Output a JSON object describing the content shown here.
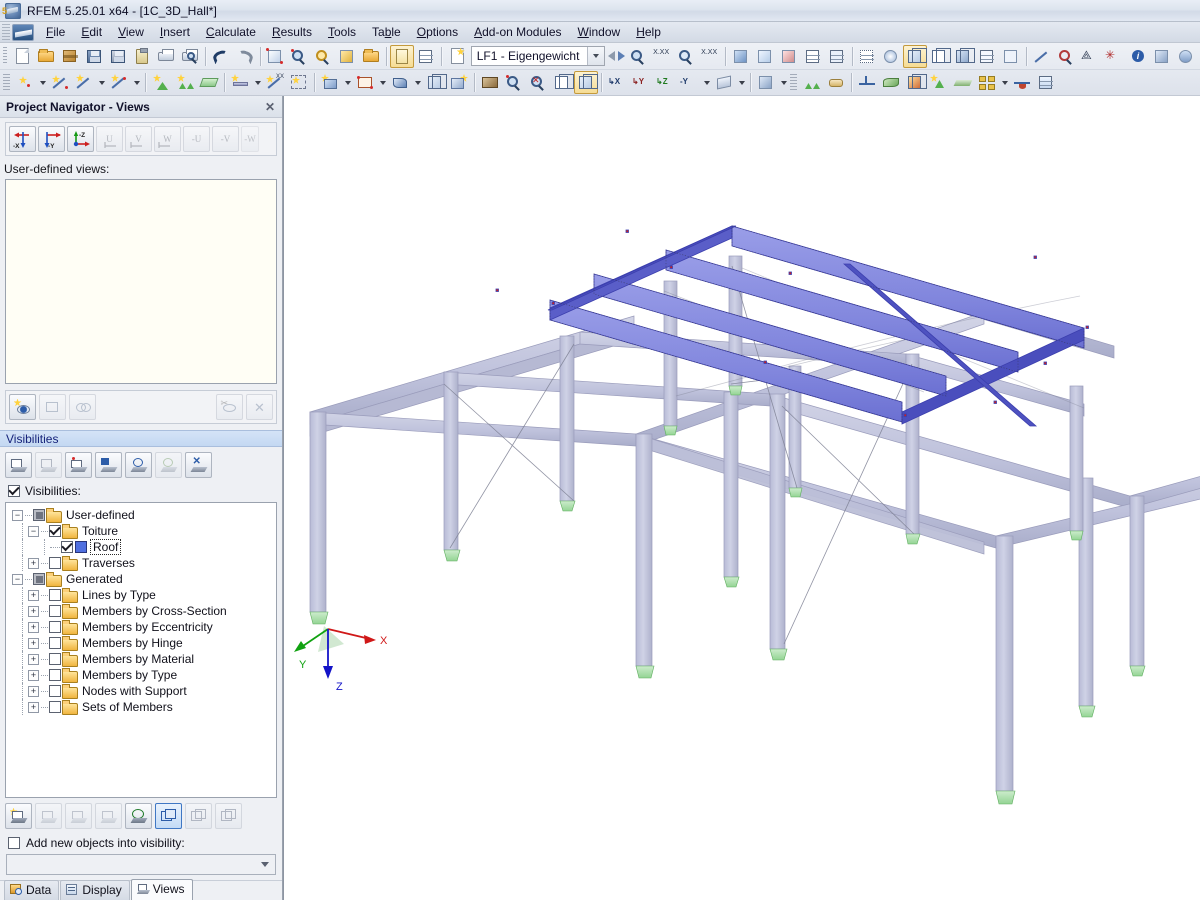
{
  "window": {
    "title": "RFEM 5.25.01 x64 - [1C_3D_Hall*]",
    "logo_icon": "rfem-logo-icon"
  },
  "menubar": {
    "app_icon": "rfem-menu-icon",
    "items": [
      {
        "label": "File",
        "accel": "F"
      },
      {
        "label": "Edit",
        "accel": "E"
      },
      {
        "label": "View",
        "accel": "V"
      },
      {
        "label": "Insert",
        "accel": "I"
      },
      {
        "label": "Calculate",
        "accel": "C"
      },
      {
        "label": "Results",
        "accel": "R"
      },
      {
        "label": "Tools",
        "accel": "T"
      },
      {
        "label": "Table",
        "accel": "b"
      },
      {
        "label": "Options",
        "accel": "O"
      },
      {
        "label": "Add-on Modules",
        "accel": "A"
      },
      {
        "label": "Window",
        "accel": "W"
      },
      {
        "label": "Help",
        "accel": "H"
      }
    ]
  },
  "toolbar_main": {
    "load_case": {
      "value": "LF1 - Eigengewicht",
      "dropdown_icon": "chevron-down-icon"
    },
    "buttons": [
      "new-document-icon",
      "open-project-icon",
      "open-model-icon",
      "save-model-icon",
      "save-icon",
      "clipboard-icon",
      "print-icon",
      "print-preview-icon",
      "undo-icon",
      "redo-icon",
      "render-model-icon",
      "select-objects-icon",
      "rotate-view-icon",
      "move-view-icon",
      "copy-icon",
      "table-report-icon",
      "table-grid-icon",
      "export-icon"
    ],
    "buttons_right": [
      "prev-load-case-icon",
      "next-load-case-icon",
      "zoom-loadcase-icon",
      "value-xxx-icon",
      "display-result-icon",
      "result-xxx-icon",
      "wind-load-icon",
      "snow-load-icon",
      "load-wizard-icon",
      "surface-loads-icon",
      "free-loads-icon",
      "grid-icon",
      "lighting-icon",
      "render-solid-icon",
      "render-wire-icon",
      "render-shade-icon",
      "grid-snap-icon",
      "snap-object-icon",
      "dimension-icon",
      "mirror-icon",
      "rotate-copy-icon",
      "scale-icon",
      "info-icon",
      "camera-icon",
      "settings-icon"
    ]
  },
  "toolbar_second": {
    "buttons": [
      "new-node-icon",
      "new-line-icon",
      "new-dimension-icon",
      "new-polyline-icon",
      "new-support-icon",
      "new-line-support-icon",
      "new-surface-icon",
      "new-member-icon",
      "new-member-xx-icon",
      "new-member-set-icon",
      "new-solid-icon",
      "new-opening-icon",
      "new-load-icon",
      "new-block-icon",
      "new-object-icon",
      "mesh-icon",
      "zoom-window-icon",
      "zoom-reset-icon",
      "wireframe-icon",
      "render-icon",
      "view-x-icon",
      "view-y-icon",
      "view-z-icon",
      "view-isometric-icon",
      "visibility-icon",
      "clip-icon",
      "nodal-support-icon",
      "line-hinge-icon",
      "member-result-icon",
      "surface-result-icon",
      "solid-result-icon",
      "add-result-icon",
      "result-diagram-icon",
      "result-panel-icon",
      "section-icon",
      "result-table-icon"
    ]
  },
  "navigator": {
    "title": "Project Navigator - Views",
    "close_icon": "close-icon",
    "view_buttons": [
      {
        "name": "view-minus-x",
        "label": "-X",
        "enabled": true
      },
      {
        "name": "view-minus-y",
        "label": "-Y",
        "enabled": true
      },
      {
        "name": "view-minus-z",
        "label": "-Z",
        "enabled": true
      },
      {
        "name": "view-u",
        "label": "U",
        "enabled": false
      },
      {
        "name": "view-v",
        "label": "V",
        "enabled": false
      },
      {
        "name": "view-w",
        "label": "W",
        "enabled": false
      },
      {
        "name": "view-minus-u",
        "label": "-U",
        "enabled": false
      },
      {
        "name": "view-minus-v",
        "label": "-V",
        "enabled": false
      },
      {
        "name": "view-minus-w",
        "label": "-W",
        "enabled": false
      }
    ],
    "user_defined_views_label": "User-defined views:",
    "user_defined_views": [],
    "list_toolbar": [
      {
        "name": "new-view-icon",
        "enabled": true
      },
      {
        "name": "edit-view-icon",
        "enabled": false
      },
      {
        "name": "duplicate-view-icon",
        "enabled": false
      },
      {
        "name": "hide-view-icon",
        "enabled": false
      },
      {
        "name": "delete-view-icon",
        "enabled": false
      }
    ],
    "visibilities": {
      "section_title": "Visibilities",
      "toolbar": [
        {
          "name": "visibility-new-icon",
          "enabled": true
        },
        {
          "name": "visibility-all-icon",
          "enabled": false
        },
        {
          "name": "visibility-selected-icon",
          "enabled": true
        },
        {
          "name": "visibility-group-icon",
          "enabled": true
        },
        {
          "name": "visibility-edit-icon",
          "enabled": true
        },
        {
          "name": "visibility-check-icon",
          "enabled": false
        },
        {
          "name": "visibility-clear-icon",
          "enabled": true
        }
      ],
      "checkbox_label": "Visibilities:",
      "checkbox_checked": true,
      "tree": [
        {
          "label": "User-defined",
          "level": 0,
          "icon": "folder-icon",
          "expander": "-",
          "check": "partial"
        },
        {
          "label": "Toiture",
          "level": 1,
          "icon": "folder-icon",
          "expander": "-",
          "check": "checked"
        },
        {
          "label": "Roof",
          "level": 2,
          "icon": "color-swatch-blue",
          "expander": "",
          "check": "checked",
          "selected": true
        },
        {
          "label": "Traverses",
          "level": 1,
          "icon": "folder-icon",
          "expander": "+",
          "check": "unchecked"
        },
        {
          "label": "Generated",
          "level": 0,
          "icon": "folder-icon",
          "expander": "-",
          "check": "partial"
        },
        {
          "label": "Lines by Type",
          "level": 1,
          "icon": "folder-icon",
          "expander": "+",
          "check": "unchecked"
        },
        {
          "label": "Members by Cross-Section",
          "level": 1,
          "icon": "folder-icon",
          "expander": "+",
          "check": "unchecked"
        },
        {
          "label": "Members by Eccentricity",
          "level": 1,
          "icon": "folder-icon",
          "expander": "+",
          "check": "unchecked"
        },
        {
          "label": "Members by Hinge",
          "level": 1,
          "icon": "folder-icon",
          "expander": "+",
          "check": "unchecked"
        },
        {
          "label": "Members by Material",
          "level": 1,
          "icon": "folder-icon",
          "expander": "+",
          "check": "unchecked"
        },
        {
          "label": "Members by Type",
          "level": 1,
          "icon": "folder-icon",
          "expander": "+",
          "check": "unchecked"
        },
        {
          "label": "Nodes with Support",
          "level": 1,
          "icon": "folder-icon",
          "expander": "+",
          "check": "unchecked"
        },
        {
          "label": "Sets of Members",
          "level": 1,
          "icon": "folder-icon",
          "expander": "+",
          "check": "unchecked"
        }
      ],
      "bottom_toolbar": [
        {
          "name": "visibility-add-icon",
          "enabled": true
        },
        {
          "name": "visibility-remove-icon",
          "enabled": false
        },
        {
          "name": "visibility-invert-icon",
          "enabled": false
        },
        {
          "name": "visibility-none-icon",
          "enabled": false
        },
        {
          "name": "visibility-apply-icon",
          "enabled": true
        },
        {
          "name": "layer-front-icon",
          "enabled": true,
          "active": true
        },
        {
          "name": "layer-middle-icon",
          "enabled": false
        },
        {
          "name": "layer-back-icon",
          "enabled": false
        }
      ],
      "add_new_label": "Add new objects into visibility:",
      "add_new_checked": false,
      "add_new_value": "",
      "add_new_dropdown_icon": "chevron-down-icon"
    },
    "tabs": [
      {
        "label": "Data",
        "icon": "data-icon",
        "active": false
      },
      {
        "label": "Display",
        "icon": "display-icon",
        "active": false
      },
      {
        "label": "Views",
        "icon": "views-icon",
        "active": true
      }
    ]
  },
  "viewport": {
    "axes": [
      {
        "label": "X",
        "color": "#d01818"
      },
      {
        "label": "Y",
        "color": "#11a211"
      },
      {
        "label": "Z",
        "color": "#1414c8"
      }
    ],
    "colors": {
      "member_fill": "#c3c5de",
      "member_edge": "#9a9cbb",
      "roof_highlight_fill": "#8b8fe0",
      "roof_highlight_edge": "#3c3fae",
      "support_green": "#a8e0a8",
      "node_red": "#cc2020",
      "background": "#ffffff"
    }
  }
}
